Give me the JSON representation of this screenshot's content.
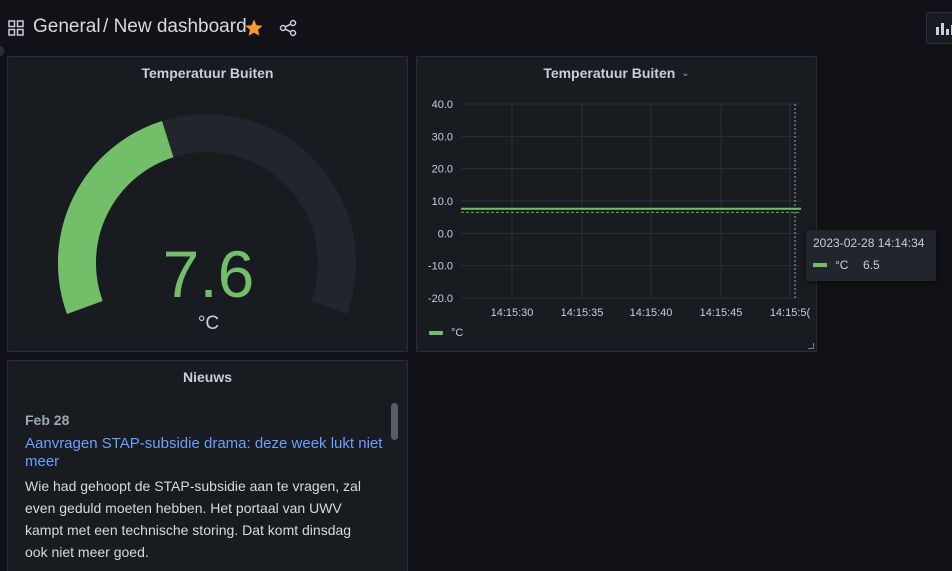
{
  "header": {
    "folder": "General",
    "separator": "/",
    "dashboard_title": "New dashboard",
    "icons": [
      "grid-icon",
      "star-icon",
      "share-icon",
      "add-panel-icon"
    ],
    "star_color": "#ff9830"
  },
  "gauge": {
    "title": "Temperatuur Buiten",
    "value": "7.6",
    "unit": "°C",
    "fill_fraction": 0.42,
    "color": "#73bf69",
    "track_color": "#22252c"
  },
  "timeseries": {
    "title": "Temperatuur Buiten",
    "legend_label": "°C",
    "color": "#73bf69",
    "tooltip": {
      "time": "2023-02-28 14:14:34",
      "series": "°C",
      "value": "6.5"
    }
  },
  "chart_data": {
    "type": "line",
    "x": [
      "14:15:25",
      "14:15:52"
    ],
    "series": [
      {
        "name": "°C",
        "values": [
          7.6,
          7.6
        ]
      }
    ],
    "y_ticks": [
      "40.0",
      "30.0",
      "20.0",
      "10.0",
      "0.0",
      "-10.0",
      "-20.0"
    ],
    "x_ticks": [
      "14:15:30",
      "14:15:35",
      "14:15:40",
      "14:15:45",
      "14:15:5("
    ],
    "ylim": [
      -20,
      40
    ],
    "threshold": 6.5,
    "grid": true,
    "legend": "bottom-left"
  },
  "news": {
    "title": "Nieuws",
    "date": "Feb 28",
    "headline": "Aanvragen STAP-subsidie drama: deze week lukt niet meer",
    "body": "Wie had gehoopt de STAP-subsidie aan te vragen, zal even geduld moeten hebben. Het portaal van UWV kampt met een technische storing. Dat komt dinsdag ook niet meer goed."
  }
}
